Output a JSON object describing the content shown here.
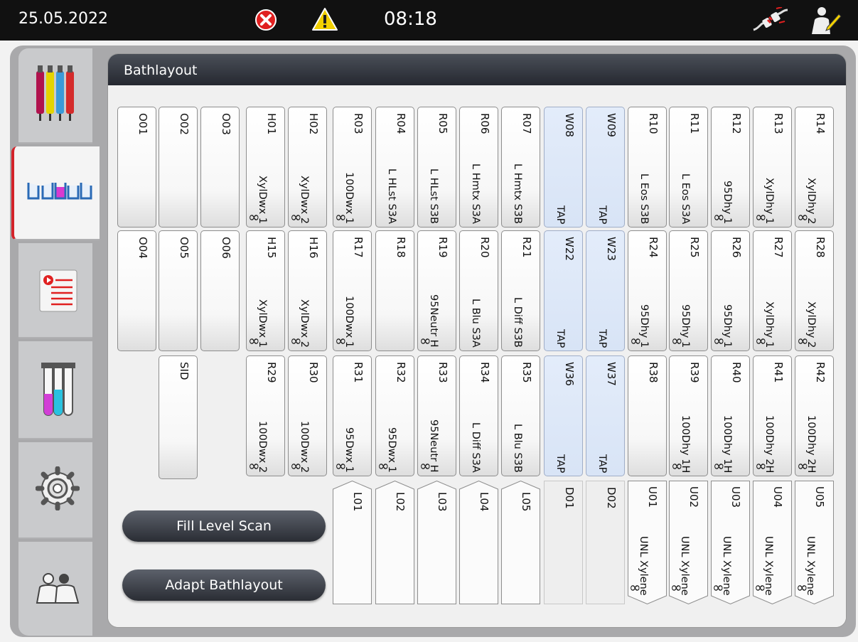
{
  "topbar": {
    "date": "25.05.2022",
    "time": "08:18"
  },
  "panel": {
    "title": "Bathlayout"
  },
  "buttons": {
    "fill_level_scan": "Fill Level Scan",
    "adapt_bathlayout": "Adapt Bathlayout"
  },
  "sidebar": {
    "tabs": [
      "reagents",
      "bathlayout",
      "programs",
      "reagent-station",
      "settings",
      "user"
    ],
    "active": "bathlayout"
  },
  "colors": {
    "active_tab_accent": "#d3232a",
    "error": "#e02020",
    "warning": "#f2d000",
    "water_station": "#dde7f7"
  },
  "rows": [
    {
      "cells": [
        {
          "id": "O01",
          "type": "oven"
        },
        {
          "id": "O02",
          "type": "oven"
        },
        {
          "id": "O03",
          "type": "oven"
        },
        {
          "id": "H01",
          "name": "XylDwx 1",
          "inf": true
        },
        {
          "id": "H02",
          "name": "XylDwx 2",
          "inf": true
        },
        {
          "id": "R03",
          "name": "100Dwx 1",
          "inf": true
        },
        {
          "id": "R04",
          "name": "L HLst S3A"
        },
        {
          "id": "R05",
          "name": "L HLst S3B"
        },
        {
          "id": "R06",
          "name": "L Hmtx S3A"
        },
        {
          "id": "R07",
          "name": "L Hmtx S3B"
        },
        {
          "id": "W08",
          "name": "TAP",
          "type": "water"
        },
        {
          "id": "W09",
          "name": "TAP",
          "type": "water"
        },
        {
          "id": "R10",
          "name": "L Eos S3B"
        },
        {
          "id": "R11",
          "name": "L Eos S3A"
        },
        {
          "id": "R12",
          "name": "95Dhy 1",
          "inf": true
        },
        {
          "id": "R13",
          "name": "XylDhy 1",
          "inf": true
        },
        {
          "id": "R14",
          "name": "XylDhy 2",
          "inf": true
        }
      ]
    },
    {
      "cells": [
        {
          "id": "O04",
          "type": "oven"
        },
        {
          "id": "O05",
          "type": "oven"
        },
        {
          "id": "O06",
          "type": "oven"
        },
        {
          "id": "H15",
          "name": "XylDwx 1",
          "inf": true
        },
        {
          "id": "H16",
          "name": "XylDwx 2",
          "inf": true
        },
        {
          "id": "R17",
          "name": "100Dwx 1",
          "inf": true
        },
        {
          "id": "R18",
          "name": ""
        },
        {
          "id": "R19",
          "name": "95Neutr H",
          "inf": true
        },
        {
          "id": "R20",
          "name": "L Blu S3A"
        },
        {
          "id": "R21",
          "name": "L Diff S3B"
        },
        {
          "id": "W22",
          "name": "TAP",
          "type": "water"
        },
        {
          "id": "W23",
          "name": "TAP",
          "type": "water"
        },
        {
          "id": "R24",
          "name": "95Dhy 1",
          "inf": true
        },
        {
          "id": "R25",
          "name": "95Dhy 1",
          "inf": true
        },
        {
          "id": "R26",
          "name": "95Dhy 1",
          "inf": true
        },
        {
          "id": "R27",
          "name": "XylDhy 1",
          "inf": true
        },
        {
          "id": "R28",
          "name": "XylDhy 2",
          "inf": true
        }
      ]
    },
    {
      "cells": [
        {
          "id": "SID",
          "type": "sid"
        },
        {
          "id": "R29",
          "name": "100Dwx 2",
          "inf": true
        },
        {
          "id": "R30",
          "name": "100Dwx 2",
          "inf": true
        },
        {
          "id": "R31",
          "name": "95Dwx 1",
          "inf": true
        },
        {
          "id": "R32",
          "name": "95Dwx 1",
          "inf": true
        },
        {
          "id": "R33",
          "name": "95Neutr H",
          "inf": true
        },
        {
          "id": "R34",
          "name": "L Diff S3A"
        },
        {
          "id": "R35",
          "name": "L Blu S3B"
        },
        {
          "id": "W36",
          "name": "TAP",
          "type": "water"
        },
        {
          "id": "W37",
          "name": "TAP",
          "type": "water"
        },
        {
          "id": "R38",
          "name": ""
        },
        {
          "id": "R39",
          "name": "100Dhy 1H",
          "inf": true
        },
        {
          "id": "R40",
          "name": "100Dhy 1H",
          "inf": true
        },
        {
          "id": "R41",
          "name": "100Dhy 2H",
          "inf": true
        },
        {
          "id": "R42",
          "name": "100Dhy 2H",
          "inf": true
        }
      ]
    },
    {
      "cells": [
        {
          "id": "L01",
          "type": "load"
        },
        {
          "id": "L02",
          "type": "load"
        },
        {
          "id": "L03",
          "type": "load"
        },
        {
          "id": "L04",
          "type": "load"
        },
        {
          "id": "L05",
          "type": "load"
        },
        {
          "id": "D01",
          "type": "drain"
        },
        {
          "id": "D02",
          "type": "drain"
        },
        {
          "id": "U01",
          "name": "UNL Xylene",
          "inf": true,
          "type": "unload"
        },
        {
          "id": "U02",
          "name": "UNL Xylene",
          "inf": true,
          "type": "unload"
        },
        {
          "id": "U03",
          "name": "UNL Xylene",
          "inf": true,
          "type": "unload"
        },
        {
          "id": "U04",
          "name": "UNL Xylene",
          "inf": true,
          "type": "unload"
        },
        {
          "id": "U05",
          "name": "UNL Xylene",
          "inf": true,
          "type": "unload"
        }
      ]
    }
  ],
  "infinity_symbol": "∞"
}
